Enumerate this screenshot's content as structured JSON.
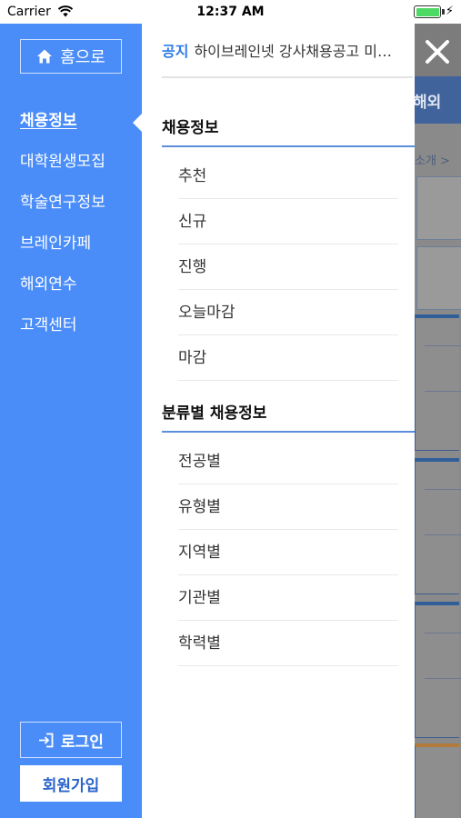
{
  "status_bar": {
    "carrier": "Carrier",
    "time": "12:37 AM",
    "battery_level": 1.0
  },
  "sidebar": {
    "home_button": "홈으로",
    "items": [
      {
        "label": "채용정보",
        "active": true
      },
      {
        "label": "대학원생모집",
        "active": false
      },
      {
        "label": "학술연구정보",
        "active": false
      },
      {
        "label": "브레인카페",
        "active": false
      },
      {
        "label": "해외연수",
        "active": false
      },
      {
        "label": "고객센터",
        "active": false
      }
    ],
    "login_button": "로그인",
    "signup_button": "회원가입"
  },
  "notice": {
    "tag": "공지",
    "text": "하이브레인넷 강사채용공고 미…"
  },
  "sections": [
    {
      "title": "채용정보",
      "items": [
        "추천",
        "신규",
        "진행",
        "오늘마감",
        "마감"
      ]
    },
    {
      "title": "분류별 채용정보",
      "items": [
        "전공별",
        "유형별",
        "지역별",
        "기관별",
        "학력별"
      ]
    }
  ],
  "background": {
    "nav_text": "해외",
    "intro_text": "소개 >"
  },
  "colors": {
    "sidebar": "#4b8df8",
    "accent": "#2f7be8",
    "section_rule": "#5b8fdc",
    "overlay": "#8a8a8a"
  },
  "icons": {
    "home": "home-icon",
    "login": "login-icon",
    "close": "close-icon",
    "wifi": "wifi-icon",
    "battery": "battery-icon"
  }
}
